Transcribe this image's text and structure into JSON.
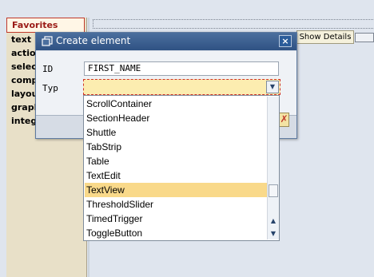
{
  "sidebar": {
    "items": [
      {
        "label": "Favorites",
        "active": true
      },
      {
        "label": "text"
      },
      {
        "label": "actio"
      },
      {
        "label": "selec"
      },
      {
        "label": "comp"
      },
      {
        "label": "layou"
      },
      {
        "label": "graph"
      },
      {
        "label": "integ"
      }
    ]
  },
  "toolbar": {
    "details_label": "Show Details"
  },
  "dialog": {
    "title": "Create element",
    "close_label": "×",
    "id_label": "ID",
    "id_value": "FIRST_NAME",
    "typ_label": "Typ",
    "typ_value": ""
  },
  "dropdown": {
    "options": [
      "ScrollContainer",
      "SectionHeader",
      "Shuttle",
      "TabStrip",
      "Table",
      "TextEdit",
      "TextView",
      "ThresholdSlider",
      "TimedTrigger",
      "ToggleButton"
    ],
    "selected": "TextView"
  },
  "colors": {
    "title_bar": "#2f5283",
    "selected_option": "#f9d98a",
    "select_field": "#fcedb0",
    "sidebar_bg": "#e8e0c8",
    "active_item": "#9a1a16"
  }
}
